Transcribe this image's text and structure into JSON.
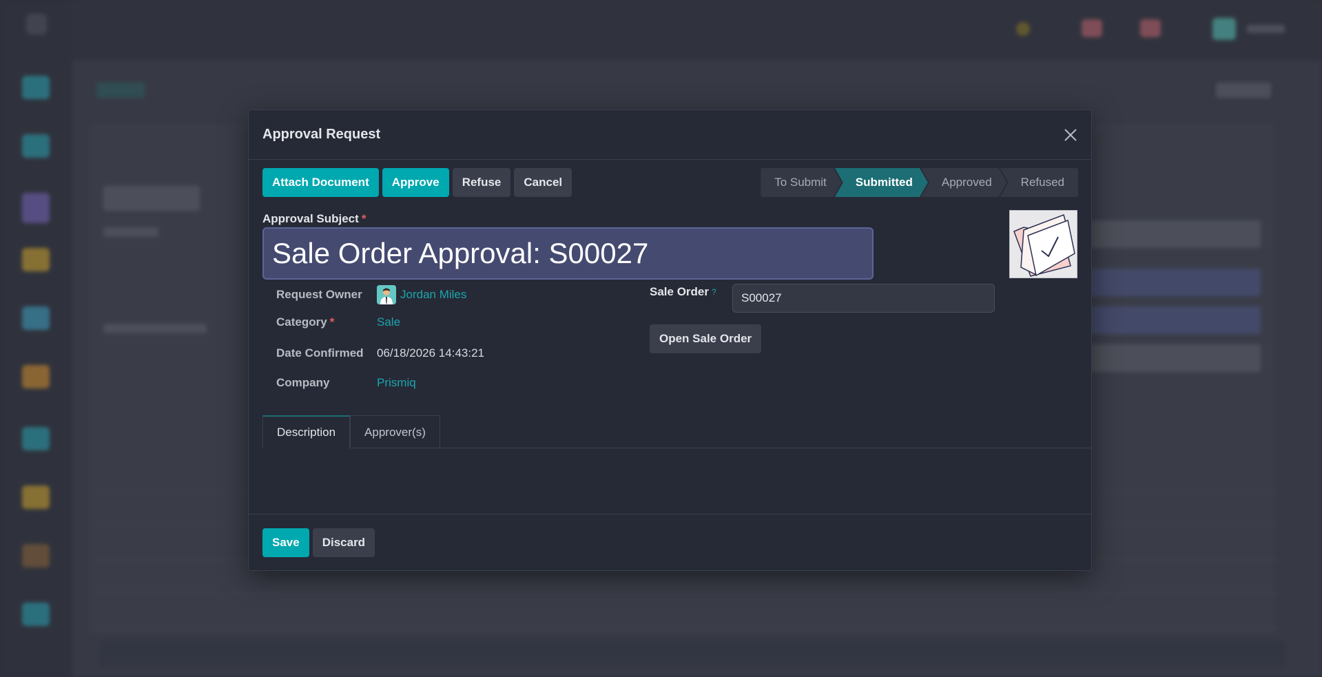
{
  "modal": {
    "title": "Approval Request"
  },
  "toolbar": {
    "attach_label": "Attach Document",
    "approve_label": "Approve",
    "refuse_label": "Refuse",
    "cancel_label": "Cancel"
  },
  "statusbar": {
    "stages": [
      "To Submit",
      "Submitted",
      "Approved",
      "Refused"
    ],
    "active": "Submitted"
  },
  "form": {
    "subject_label": "Approval Subject",
    "subject_value": "Sale Order Approval: S00027",
    "owner_label": "Request Owner",
    "owner_value": "Jordan Miles",
    "category_label": "Category",
    "category_value": "Sale",
    "date_label": "Date Confirmed",
    "date_value": "06/18/2026 14:43:21",
    "company_label": "Company",
    "company_value": "Prismiq",
    "sale_order_label": "Sale Order",
    "sale_order_help": "?",
    "sale_order_value": "S00027",
    "open_sale_order_label": "Open Sale Order"
  },
  "tabs": {
    "description_label": "Description",
    "approvers_label": "Approver(s)"
  },
  "footer": {
    "save_label": "Save",
    "discard_label": "Discard"
  },
  "colors": {
    "primary": "#00a8b0",
    "link": "#1ca5ad",
    "modal_bg": "#262a36",
    "required": "#e05c5c"
  }
}
